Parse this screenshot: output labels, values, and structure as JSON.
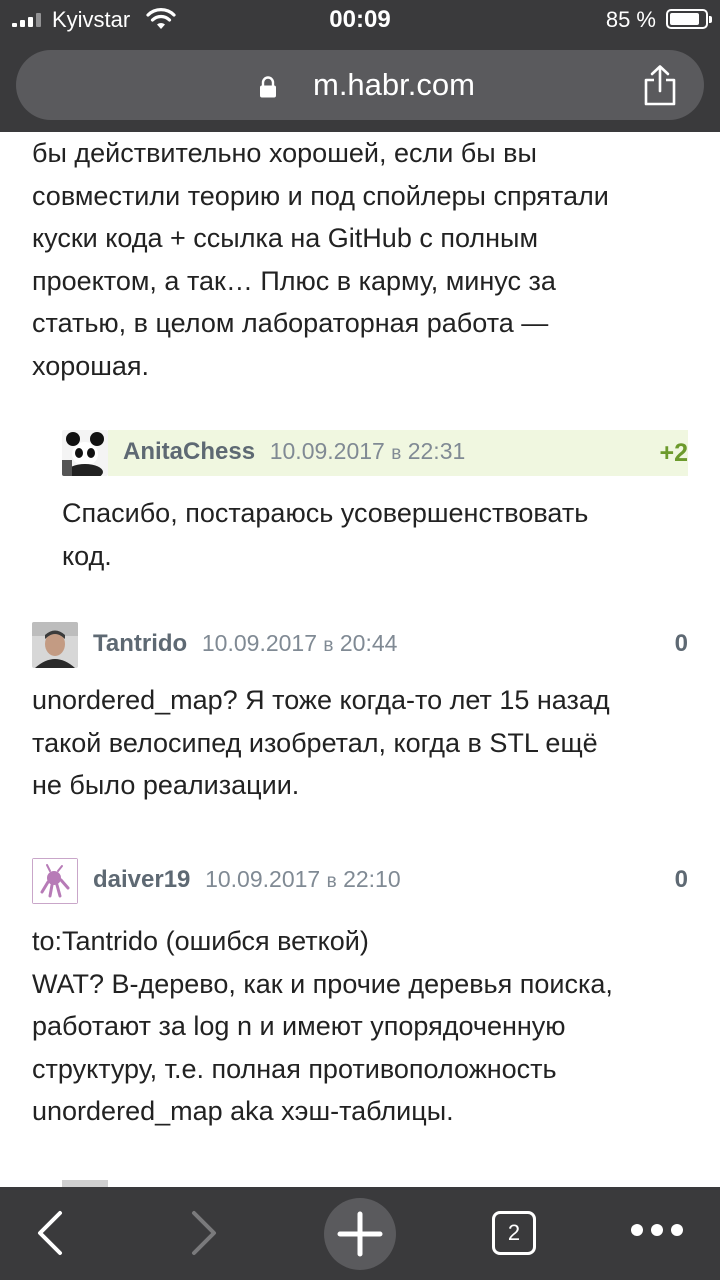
{
  "status": {
    "carrier": "Kyivstar",
    "time": "00:09",
    "battery_pct": "85 %",
    "battery_level": 0.85
  },
  "browser": {
    "url": "m.habr.com",
    "tab_count": "2",
    "icons": [
      "lock-icon",
      "share-icon",
      "back-icon",
      "forward-icon",
      "new-tab-icon",
      "tabs-icon",
      "more-icon"
    ]
  },
  "comments": {
    "partial_body": "бы действительно хорошей, если бы вы\nсовместили теорию и под спойлеры спрятали\nкуски кода + ссылка на GitHub с полным\nпроектом, а так… Плюс в карму, минус за\nстатью, в целом лабораторная работа —\nхорошая.",
    "items": [
      {
        "user": "AnitaChess",
        "date": "10.09.2017",
        "at": "в",
        "time": "22:31",
        "score": "+2",
        "body": "Спасибо, постараюсь усовершенствовать\nкод."
      },
      {
        "user": "Tantrido",
        "date": "10.09.2017",
        "at": "в",
        "time": "20:44",
        "score": "0",
        "body": "unordered_map? Я тоже когда-то лет 15 назад\nтакой велосипед изобретал, когда в STL ещё\nне было реализации."
      },
      {
        "user": "daiver19",
        "date": "10.09.2017",
        "at": "в",
        "time": "22:10",
        "score": "0",
        "body": "to:Tantrido (ошибся веткой)\nWAT? В-дерево, как и прочие деревья поиска,\nработают за log n и имеют упорядоченную\nструктуру, т.е. полная противоположность\nunordered_map aka хэш-таблицы."
      }
    ]
  },
  "colors": {
    "chrome": "#3a3a3c",
    "highlight_bg": "#f0f7e0",
    "positive_score": "#6c9a2c",
    "meta_text": "#5e6973"
  }
}
